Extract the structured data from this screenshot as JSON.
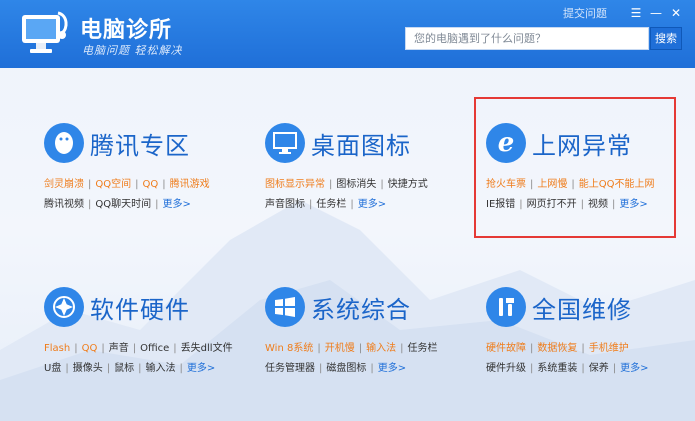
{
  "app": {
    "title": "电脑诊所",
    "slogan": "电脑问题 轻松解决"
  },
  "top_links": {
    "submit": "提交问题"
  },
  "search": {
    "placeholder": "您的电脑遇到了什么问题？",
    "button": "搜索"
  },
  "colors": {
    "brand": "#1f6fd8",
    "accent_orange": "#ef7d1c",
    "highlight_border": "#e53935"
  },
  "categories": [
    {
      "title": "腾讯专区",
      "icon": "qq-penguin-icon",
      "row1": [
        {
          "t": "剑灵崩溃",
          "hot": true
        },
        {
          "t": "QQ空间",
          "hot": true
        },
        {
          "t": "QQ",
          "hot": true
        },
        {
          "t": "腾讯游戏",
          "hot": true
        }
      ],
      "row2": [
        {
          "t": "腾讯视频"
        },
        {
          "t": "QQ聊天时间"
        },
        {
          "t": "更多>",
          "more": true
        }
      ]
    },
    {
      "title": "桌面图标",
      "icon": "monitor-icon",
      "row1": [
        {
          "t": "图标显示异常",
          "hot": true
        },
        {
          "t": "图标消失"
        },
        {
          "t": "快捷方式"
        }
      ],
      "row2": [
        {
          "t": "声音图标"
        },
        {
          "t": "任务栏"
        },
        {
          "t": "更多>",
          "more": true
        }
      ]
    },
    {
      "title": "上网异常",
      "icon": "ie-browser-icon",
      "row1": [
        {
          "t": "抢火车票",
          "hot": true
        },
        {
          "t": "上网慢",
          "hot": true
        },
        {
          "t": "能上QQ不能上网",
          "hot": true
        }
      ],
      "row2": [
        {
          "t": "IE报错"
        },
        {
          "t": "网页打不开"
        },
        {
          "t": "视频"
        },
        {
          "t": "更多>",
          "more": true
        }
      ]
    },
    {
      "title": "软件硬件",
      "icon": "software-hardware-icon",
      "row1": [
        {
          "t": "Flash",
          "hot": true
        },
        {
          "t": "QQ",
          "hot": true
        },
        {
          "t": "声音"
        },
        {
          "t": "Office"
        },
        {
          "t": "丢失dll文件"
        }
      ],
      "row2": [
        {
          "t": "U盘"
        },
        {
          "t": "摄像头"
        },
        {
          "t": "鼠标"
        },
        {
          "t": "输入法"
        },
        {
          "t": "更多>",
          "more": true
        }
      ]
    },
    {
      "title": "系统综合",
      "icon": "windows-logo-icon",
      "row1": [
        {
          "t": "Win 8系统",
          "hot": true
        },
        {
          "t": "开机慢",
          "hot": true
        },
        {
          "t": "输入法",
          "hot": true
        },
        {
          "t": "任务栏"
        }
      ],
      "row2": [
        {
          "t": "任务管理器"
        },
        {
          "t": "磁盘图标"
        },
        {
          "t": "更多>",
          "more": true
        }
      ]
    },
    {
      "title": "全国维修",
      "icon": "repair-tools-icon",
      "row1": [
        {
          "t": "硬件故障",
          "hot": true
        },
        {
          "t": "数据恢复",
          "hot": true
        },
        {
          "t": "手机维护",
          "hot": true
        }
      ],
      "row2": [
        {
          "t": "硬件升级"
        },
        {
          "t": "系统重装"
        },
        {
          "t": "保养"
        },
        {
          "t": "更多>",
          "more": true
        }
      ]
    }
  ]
}
